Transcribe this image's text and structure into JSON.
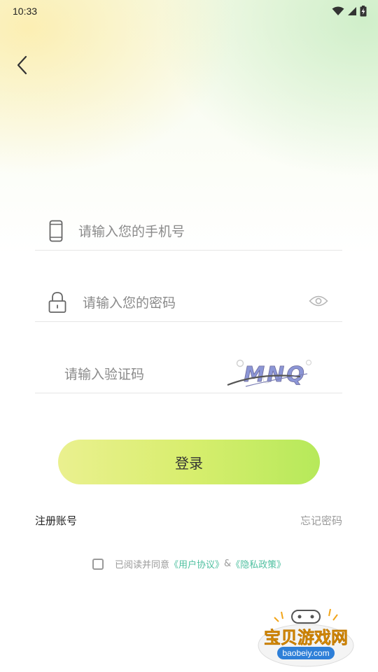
{
  "status": {
    "time": "10:33"
  },
  "form": {
    "phone_placeholder": "请输入您的手机号",
    "password_placeholder": "请输入您的密码",
    "captcha_placeholder": "请输入验证码",
    "captcha_text": "MNQ"
  },
  "actions": {
    "login_label": "登录",
    "register_label": "注册账号",
    "forgot_label": "忘记密码"
  },
  "agreement": {
    "prefix": "已阅读并同意",
    "user_agreement": "《用户协议》",
    "and": "&",
    "privacy_policy": "《隐私政策》"
  },
  "watermark": {
    "brand": "宝贝游戏网",
    "domain": "baobeiy.com"
  },
  "colors": {
    "accent_green": "#b6e95a",
    "link": "#4fc0a0"
  }
}
